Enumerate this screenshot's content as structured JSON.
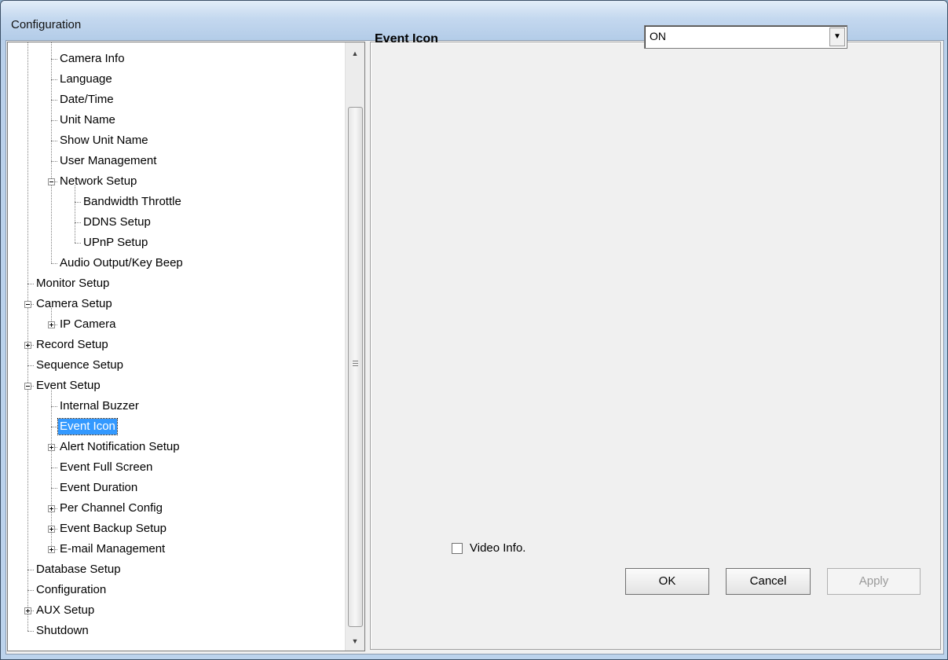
{
  "window": {
    "title": "Configuration"
  },
  "tree": {
    "items": [
      {
        "label": "Camera Info",
        "level": 2
      },
      {
        "label": "Language",
        "level": 2
      },
      {
        "label": "Date/Time",
        "level": 2
      },
      {
        "label": "Unit Name",
        "level": 2
      },
      {
        "label": "Show Unit Name",
        "level": 2
      },
      {
        "label": "User Management",
        "level": 2
      },
      {
        "label": "Network Setup",
        "level": 2,
        "expander": "minus"
      },
      {
        "label": "Bandwidth Throttle",
        "level": 3
      },
      {
        "label": "DDNS Setup",
        "level": 3
      },
      {
        "label": "UPnP Setup",
        "level": 3
      },
      {
        "label": "Audio Output/Key Beep",
        "level": 2
      },
      {
        "label": "Monitor Setup",
        "level": 1
      },
      {
        "label": "Camera Setup",
        "level": 1,
        "expander": "minus"
      },
      {
        "label": "IP Camera",
        "level": 2,
        "expander": "plus"
      },
      {
        "label": "Record Setup",
        "level": 1,
        "expander": "plus"
      },
      {
        "label": "Sequence Setup",
        "level": 1
      },
      {
        "label": "Event Setup",
        "level": 1,
        "expander": "minus"
      },
      {
        "label": "Internal Buzzer",
        "level": 2
      },
      {
        "label": "Event Icon",
        "level": 2,
        "selected": true
      },
      {
        "label": "Alert Notification Setup",
        "level": 2,
        "expander": "plus"
      },
      {
        "label": "Event Full Screen",
        "level": 2
      },
      {
        "label": "Event Duration",
        "level": 2
      },
      {
        "label": "Per Channel Config",
        "level": 2,
        "expander": "plus"
      },
      {
        "label": "Event Backup Setup",
        "level": 2,
        "expander": "plus"
      },
      {
        "label": "E-mail Management",
        "level": 2,
        "expander": "plus"
      },
      {
        "label": "Database Setup",
        "level": 1
      },
      {
        "label": "Configuration",
        "level": 1
      },
      {
        "label": "AUX Setup",
        "level": 1,
        "expander": "plus"
      },
      {
        "label": "Shutdown",
        "level": 1
      }
    ]
  },
  "settings": {
    "event_icon_label": "Event Icon",
    "event_icon_value": "ON",
    "video_info_label": "Video Info.",
    "video_info_checked": false
  },
  "buttons": {
    "ok": "OK",
    "cancel": "Cancel",
    "apply": "Apply"
  },
  "colors": {
    "selection": "#3399ff",
    "titlebar": "#c4d8ef"
  }
}
